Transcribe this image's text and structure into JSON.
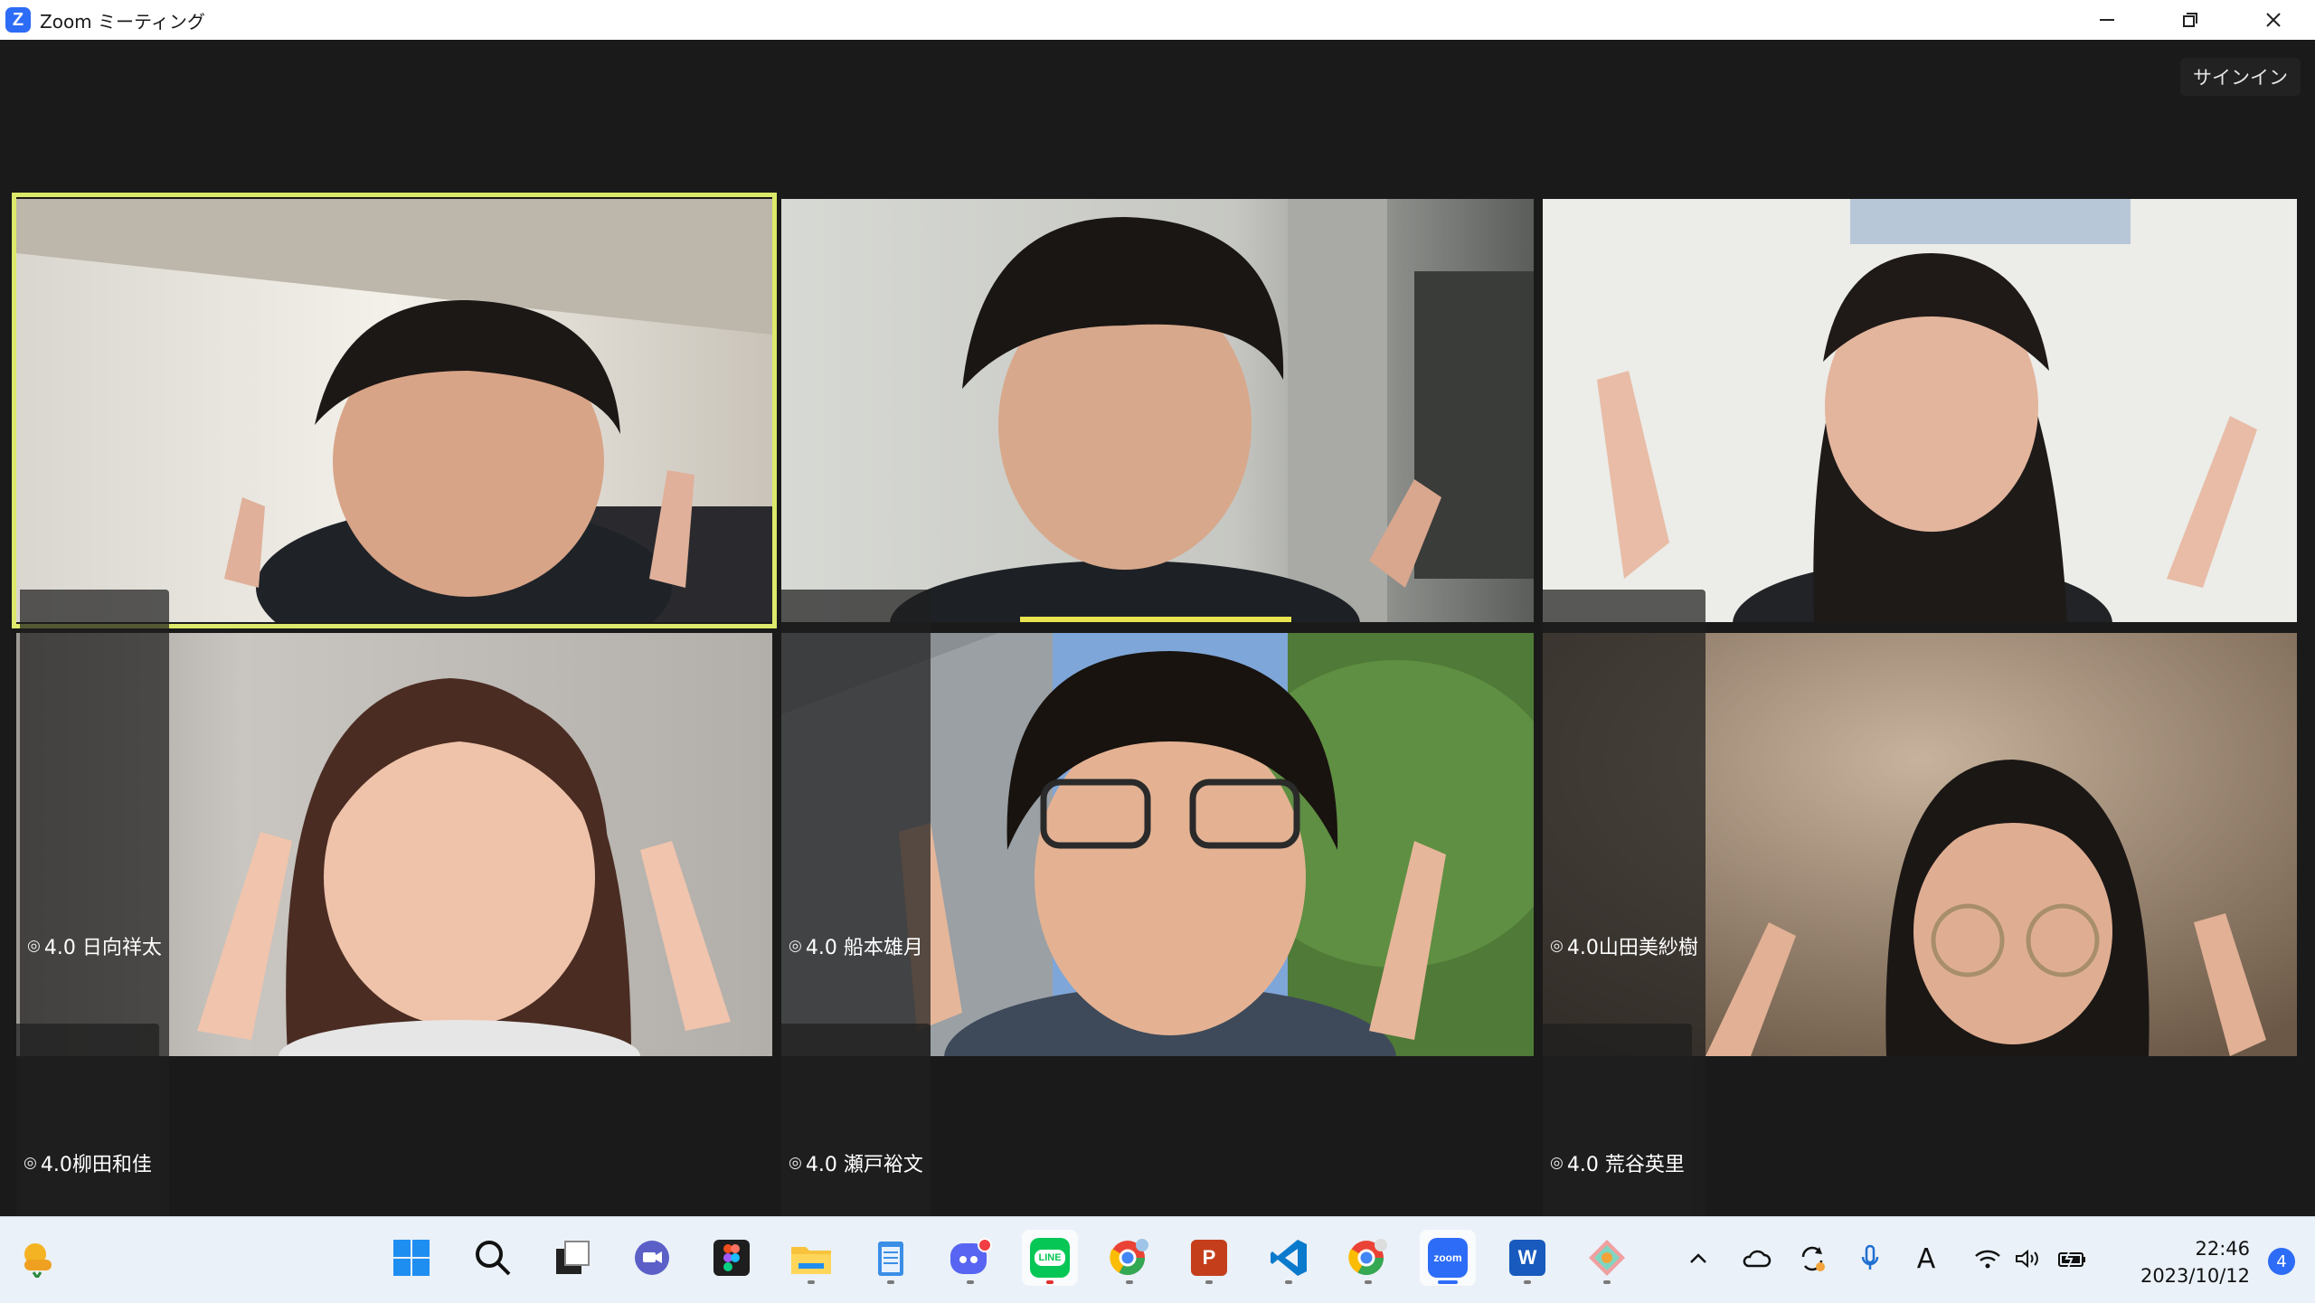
{
  "window": {
    "title": "Zoom ミーティング",
    "logo_letter": "Z"
  },
  "meeting": {
    "signin_label": "サインイン",
    "participants": [
      {
        "name": "4.0 日向祥太",
        "signal": "◎",
        "active_speaker": true
      },
      {
        "name": "4.0 船本雄月",
        "signal": "◎",
        "active_speaker": false
      },
      {
        "name": "4.0山田美紗樹",
        "signal": "◎",
        "active_speaker": false
      },
      {
        "name": "4.0柳田和佳",
        "signal": "◎",
        "active_speaker": false
      },
      {
        "name": "4.0 瀬戸裕文",
        "signal": "◎",
        "active_speaker": false
      },
      {
        "name": "4.0 荒谷英里",
        "signal": "◎",
        "active_speaker": false
      }
    ]
  },
  "taskbar": {
    "apps": [
      "weather-icon",
      "windows-start-icon",
      "search-icon",
      "task-view-icon",
      "teams-icon",
      "figma-icon",
      "file-explorer-icon",
      "notepad-icon",
      "discord-icon",
      "line-icon",
      "chrome-profile-icon",
      "powerpoint-icon",
      "vscode-icon",
      "chrome-icon",
      "zoom-icon",
      "word-icon",
      "git-icon"
    ],
    "line_label": "LINE",
    "zoom_label": "zoom",
    "word_label": "W",
    "powerpoint_label": "P",
    "clock": {
      "time": "22:46",
      "date": "2023/10/12"
    },
    "notification_count": "4",
    "ime_label": "A"
  },
  "colors": {
    "active_speaker": "#dce96a",
    "zoom_blue": "#2d6cf6",
    "meeting_bg": "#1a1a1a",
    "taskbar_bg": "#eaf1f8"
  }
}
